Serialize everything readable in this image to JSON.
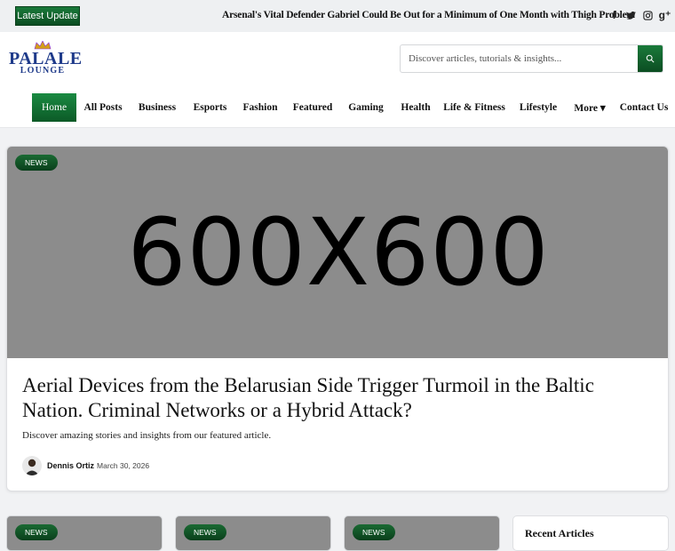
{
  "topbar": {
    "latest_label": "Latest Update",
    "ticker_text": "Arsenal's Vital Defender Gabriel Could Be Out for a Minimum of One Month with Thigh Problem",
    "socials": [
      {
        "icon": "facebook-icon",
        "glyph": "f"
      },
      {
        "icon": "twitter-icon",
        "glyph": "t"
      },
      {
        "icon": "instagram-icon",
        "glyph": "◎"
      },
      {
        "icon": "google-plus-icon",
        "glyph": "g⁺"
      }
    ]
  },
  "header": {
    "logo_name": "PALALE",
    "logo_sub": "LOUNGE",
    "search_placeholder": "Discover articles, tutorials & insights..."
  },
  "nav": {
    "items": [
      {
        "label": "Home",
        "active": true
      },
      {
        "label": "All Posts"
      },
      {
        "label": "Business"
      },
      {
        "label": "Esports"
      },
      {
        "label": "Fashion"
      },
      {
        "label": "Featured"
      },
      {
        "label": "Gaming"
      },
      {
        "label": "Health"
      },
      {
        "label": "Life & Fitness"
      },
      {
        "label": "Lifestyle"
      },
      {
        "label": "More ▾"
      },
      {
        "label": "Contact Us"
      }
    ]
  },
  "hero": {
    "badge": "NEWS",
    "image_text": "600X600",
    "title": "Aerial Devices from the Belarusian Side Trigger Turmoil in the Baltic Nation. Criminal Networks or a Hybrid Attack?",
    "description": "Discover amazing stories and insights from our featured article.",
    "author": "Dennis Ortiz",
    "date": "March 30, 2026"
  },
  "cards": [
    {
      "badge": "NEWS"
    },
    {
      "badge": "NEWS"
    },
    {
      "badge": "NEWS"
    }
  ],
  "sidebar": {
    "recent_title": "Recent Articles"
  },
  "colors": {
    "accent_green": "#0c5a27",
    "logo_blue": "#1e3a8a",
    "placeholder_gray": "#8c8c8c"
  }
}
